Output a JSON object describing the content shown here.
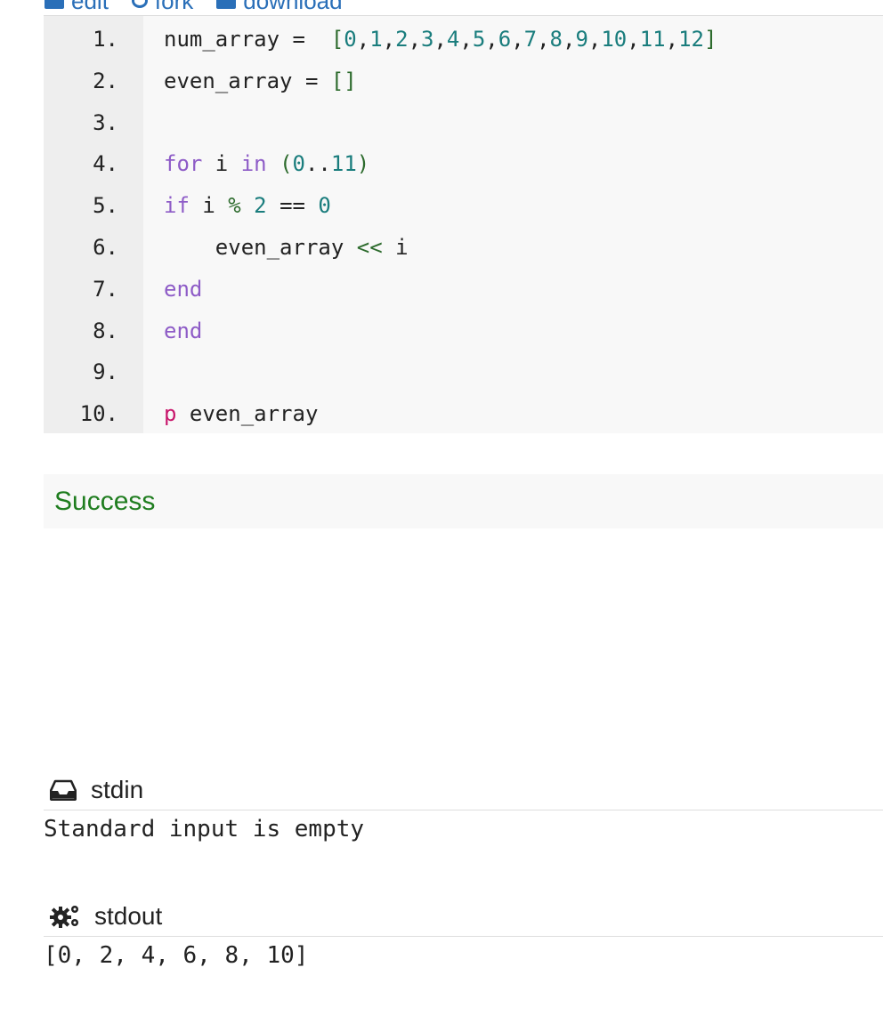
{
  "toolbar": {
    "edit_label": "edit",
    "fork_label": "fork",
    "download_label": "download"
  },
  "code": {
    "line_numbers": [
      "1.",
      "2.",
      "3.",
      "4.",
      "5.",
      "6.",
      "7.",
      "8.",
      "9.",
      "10."
    ],
    "lines": [
      "num_array =  [0,1,2,3,4,5,6,7,8,9,10,11,12]",
      "even_array = []",
      "",
      "for i in (0..11)",
      "if i % 2 == 0",
      "    even_array << i",
      "end",
      "end",
      "",
      "p even_array"
    ]
  },
  "result": {
    "status": "Success",
    "status_color": "#1f7d1f"
  },
  "stdin": {
    "title": "stdin",
    "icon": "inbox-icon",
    "content": "Standard input is empty"
  },
  "stdout": {
    "title": "stdout",
    "icon": "gears-icon",
    "content": "[0, 2, 4, 6, 8, 10]"
  },
  "colors": {
    "link": "#2a6fb8",
    "keyword": "#8e5cc7",
    "number": "#1a7d7d",
    "method": "#c8166b"
  }
}
